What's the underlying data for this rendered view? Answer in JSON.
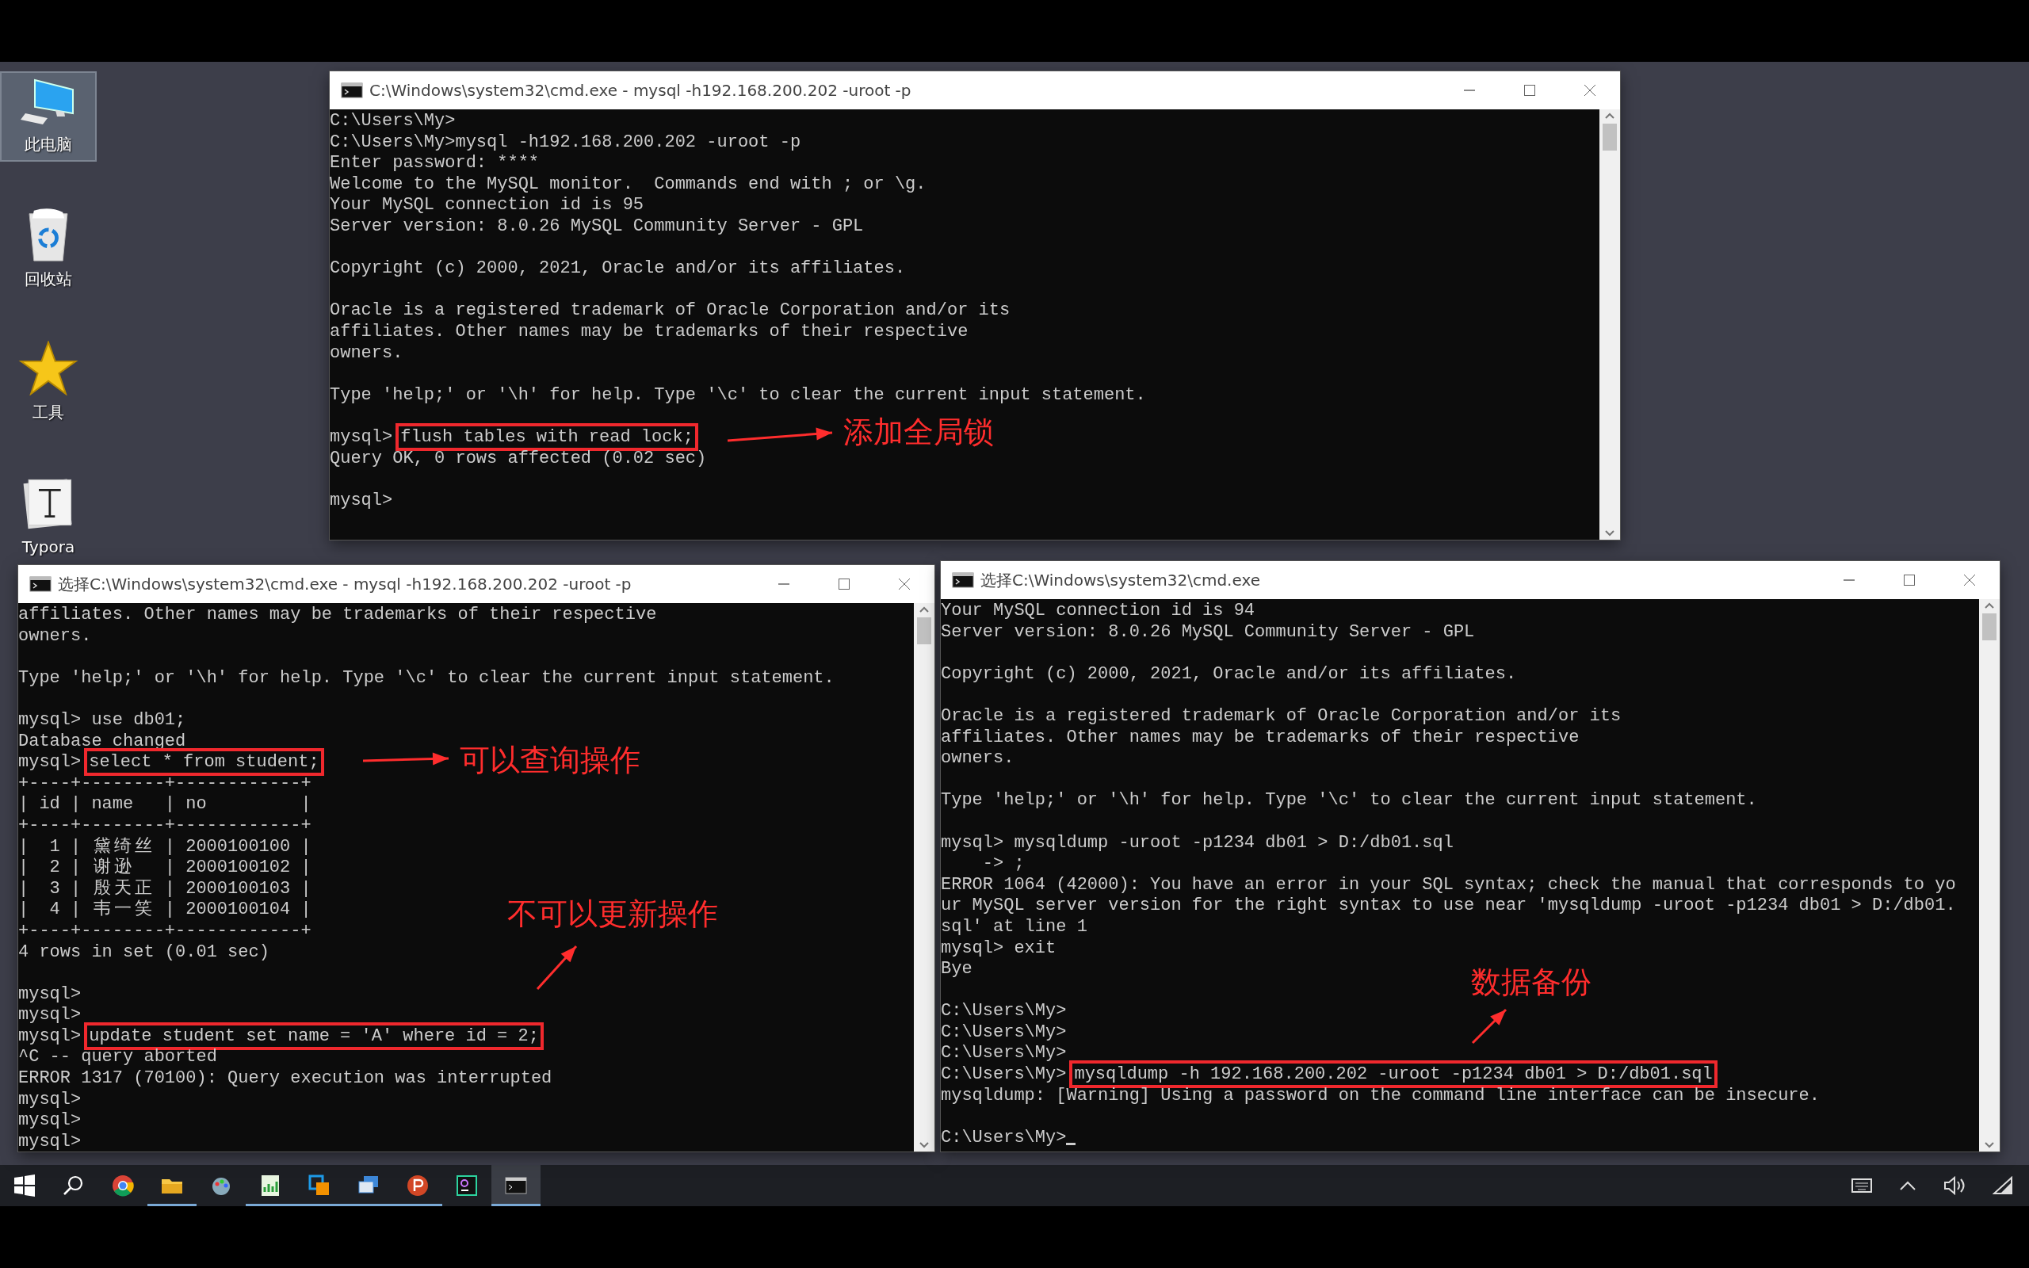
{
  "desktop_icons": [
    {
      "label": "此电脑",
      "kind": "computer",
      "selected": true
    },
    {
      "label": "回收站",
      "kind": "recycle",
      "selected": false
    },
    {
      "label": "工具",
      "kind": "star",
      "selected": false
    },
    {
      "label": "Typora",
      "kind": "typora",
      "selected": false
    }
  ],
  "windows": [
    {
      "title": "C:\\Windows\\system32\\cmd.exe - mysql  -h192.168.200.202 -uroot -p",
      "lines": [
        {
          "kind": "text",
          "text": "C:\\Users\\My>"
        },
        {
          "kind": "text",
          "text": "C:\\Users\\My>mysql -h192.168.200.202 -uroot -p"
        },
        {
          "kind": "text",
          "text": "Enter password: ****"
        },
        {
          "kind": "text",
          "text": "Welcome to the MySQL monitor.  Commands end with ; or \\g."
        },
        {
          "kind": "text",
          "text": "Your MySQL connection id is 95"
        },
        {
          "kind": "text",
          "text": "Server version: 8.0.26 MySQL Community Server - GPL"
        },
        {
          "kind": "blank"
        },
        {
          "kind": "text",
          "text": "Copyright (c) 2000, 2021, Oracle and/or its affiliates."
        },
        {
          "kind": "blank"
        },
        {
          "kind": "text",
          "text": "Oracle is a registered trademark of Oracle Corporation and/or its"
        },
        {
          "kind": "text",
          "text": "affiliates. Other names may be trademarks of their respective"
        },
        {
          "kind": "text",
          "text": "owners."
        },
        {
          "kind": "blank"
        },
        {
          "kind": "text",
          "text": "Type 'help;' or '\\h' for help. Type '\\c' to clear the current input statement."
        },
        {
          "kind": "blank"
        },
        {
          "kind": "boxed",
          "prompt": "mysql>",
          "text": "flush tables with read lock;"
        },
        {
          "kind": "text",
          "text": "Query OK, 0 rows affected (0.02 sec)"
        },
        {
          "kind": "blank"
        },
        {
          "kind": "text",
          "text": "mysql>"
        }
      ]
    },
    {
      "title": "选择C:\\Windows\\system32\\cmd.exe - mysql  -h192.168.200.202 -uroot -p",
      "lines": [
        {
          "kind": "text",
          "text": "affiliates. Other names may be trademarks of their respective"
        },
        {
          "kind": "text",
          "text": "owners."
        },
        {
          "kind": "blank"
        },
        {
          "kind": "text",
          "text": "Type 'help;' or '\\h' for help. Type '\\c' to clear the current input statement."
        },
        {
          "kind": "blank"
        },
        {
          "kind": "text",
          "text": "mysql> use db01;"
        },
        {
          "kind": "text",
          "text": "Database changed"
        },
        {
          "kind": "boxed",
          "prompt": "mysql>",
          "text": "select * from student;"
        },
        {
          "kind": "text",
          "text": "+----+--------+------------+"
        },
        {
          "kind": "text",
          "text": "| id | name   | no         |"
        },
        {
          "kind": "text",
          "text": "+----+--------+------------+"
        },
        {
          "kind": "text",
          "text": "|  1 | 黛绮丝 | 2000100100 |"
        },
        {
          "kind": "text",
          "text": "|  2 | 谢逊   | 2000100102 |"
        },
        {
          "kind": "text",
          "text": "|  3 | 殷天正 | 2000100103 |"
        },
        {
          "kind": "text",
          "text": "|  4 | 韦一笑 | 2000100104 |"
        },
        {
          "kind": "text",
          "text": "+----+--------+------------+"
        },
        {
          "kind": "text",
          "text": "4 rows in set (0.01 sec)"
        },
        {
          "kind": "blank"
        },
        {
          "kind": "text",
          "text": "mysql>"
        },
        {
          "kind": "text",
          "text": "mysql>"
        },
        {
          "kind": "boxed",
          "prompt": "mysql>",
          "text": "update student set name = 'A' where id = 2;"
        },
        {
          "kind": "text",
          "text": "^C -- query aborted"
        },
        {
          "kind": "text",
          "text": "ERROR 1317 (70100): Query execution was interrupted"
        },
        {
          "kind": "text",
          "text": "mysql>"
        },
        {
          "kind": "text",
          "text": "mysql>"
        },
        {
          "kind": "text",
          "text": "mysql>"
        }
      ]
    },
    {
      "title": "选择C:\\Windows\\system32\\cmd.exe",
      "lines": [
        {
          "kind": "text",
          "text": "Your MySQL connection id is 94"
        },
        {
          "kind": "text",
          "text": "Server version: 8.0.26 MySQL Community Server - GPL"
        },
        {
          "kind": "blank"
        },
        {
          "kind": "text",
          "text": "Copyright (c) 2000, 2021, Oracle and/or its affiliates."
        },
        {
          "kind": "blank"
        },
        {
          "kind": "text",
          "text": "Oracle is a registered trademark of Oracle Corporation and/or its"
        },
        {
          "kind": "text",
          "text": "affiliates. Other names may be trademarks of their respective"
        },
        {
          "kind": "text",
          "text": "owners."
        },
        {
          "kind": "blank"
        },
        {
          "kind": "text",
          "text": "Type 'help;' or '\\h' for help. Type '\\c' to clear the current input statement."
        },
        {
          "kind": "blank"
        },
        {
          "kind": "text",
          "text": "mysql> mysqldump -uroot -p1234 db01 > D:/db01.sql"
        },
        {
          "kind": "text",
          "text": "    -> ;"
        },
        {
          "kind": "text",
          "text": "ERROR 1064 (42000): You have an error in your SQL syntax; check the manual that corresponds to yo"
        },
        {
          "kind": "text",
          "text": "ur MySQL server version for the right syntax to use near 'mysqldump -uroot -p1234 db01 > D:/db01."
        },
        {
          "kind": "text",
          "text": "sql' at line 1"
        },
        {
          "kind": "text",
          "text": "mysql> exit"
        },
        {
          "kind": "text",
          "text": "Bye"
        },
        {
          "kind": "blank"
        },
        {
          "kind": "text",
          "text": "C:\\Users\\My>"
        },
        {
          "kind": "text",
          "text": "C:\\Users\\My>"
        },
        {
          "kind": "text",
          "text": "C:\\Users\\My>"
        },
        {
          "kind": "boxed",
          "prompt": "C:\\Users\\My>",
          "text": "mysqldump -h 192.168.200.202 -uroot -p1234 db01 > D:/db01.sql"
        },
        {
          "kind": "text",
          "text": "mysqldump: [Warning] Using a password on the command line interface can be insecure."
        },
        {
          "kind": "blank"
        },
        {
          "kind": "cursor",
          "text": "C:\\Users\\My>"
        }
      ]
    }
  ],
  "annotations": [
    {
      "text": "添加全局锁"
    },
    {
      "text": "可以查询操作"
    },
    {
      "text": "不可以更新操作"
    },
    {
      "text": "数据备份"
    }
  ],
  "taskbar": [
    {
      "kind": "start",
      "running": false
    },
    {
      "kind": "search",
      "running": false
    },
    {
      "kind": "browser",
      "running": false
    },
    {
      "kind": "folder",
      "running": true
    },
    {
      "kind": "paint",
      "running": false
    },
    {
      "kind": "chart",
      "running": true
    },
    {
      "kind": "copy",
      "running": true
    },
    {
      "kind": "monitor",
      "running": true
    },
    {
      "kind": "slides",
      "running": true
    },
    {
      "kind": "db",
      "running": false
    },
    {
      "kind": "terminal",
      "running": true
    }
  ]
}
